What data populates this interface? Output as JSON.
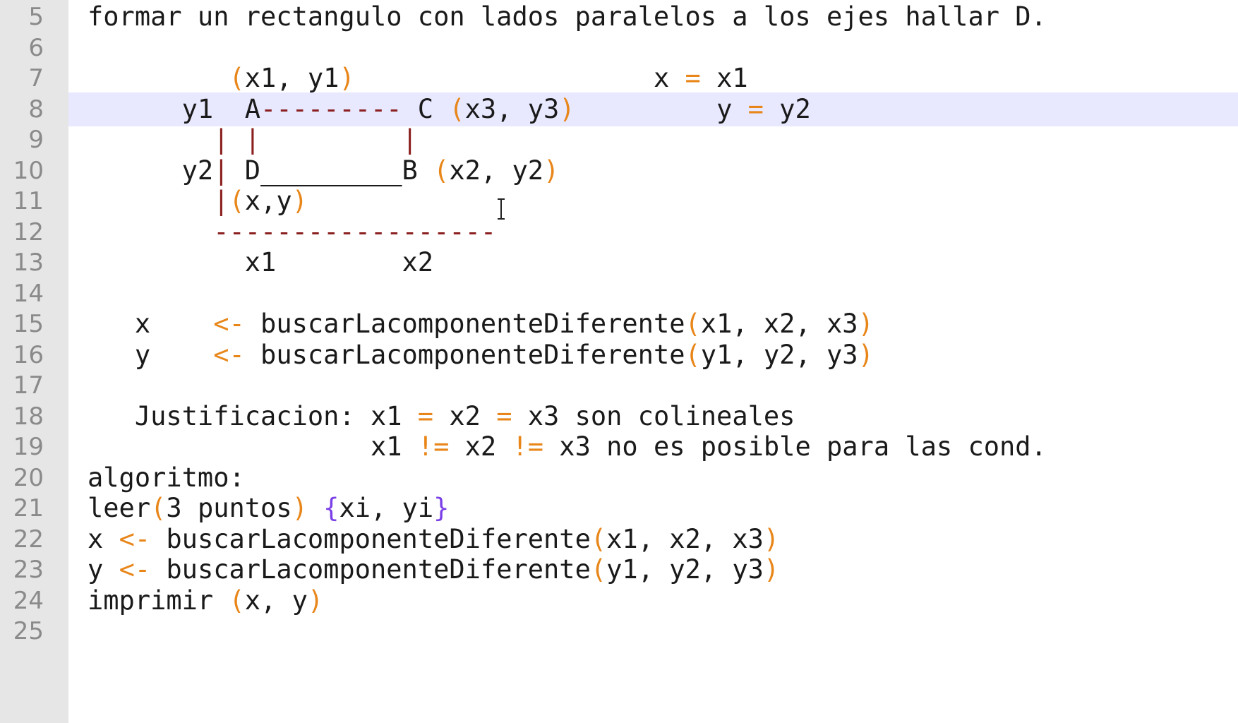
{
  "editor": {
    "line_numbers": [
      "5",
      "6",
      "7",
      "8",
      "9",
      "10",
      "11",
      "12",
      "13",
      "14",
      "15",
      "16",
      "17",
      "18",
      "19",
      "20",
      "21",
      "22",
      "23",
      "24",
      "25"
    ],
    "active_line_number": "8",
    "colors": {
      "gutter_bg": "#e6e6e6",
      "active_line_bg": "#e8e8ff",
      "operator": "#e8861a",
      "brace": "#7a3fe6",
      "dashes": "#8b2020"
    },
    "lines": {
      "l5": "formar un rectangulo con lados paralelos a los ejes hallar D.",
      "l7": {
        "p1": "         ",
        "lp": "(",
        "t1": "x1, y1",
        "rp": ")",
        "sp": "                   ",
        "t2": "x ",
        "eq": "=",
        "t3": " x1"
      },
      "l8": {
        "t1": "      y1  A",
        "dash": "---------",
        "t2": " C ",
        "lp": "(",
        "t3": "x3, y3",
        "rp": ")",
        "sp": "         ",
        "t4": "y ",
        "eq": "=",
        "t5": " y2"
      },
      "l9": {
        "p1": "        ",
        "bar1": "|",
        "sp1": " ",
        "bar2": "|",
        "sp2": "         ",
        "bar3": "|"
      },
      "l10": {
        "t1": "      y2",
        "bar": "|",
        "t2": " D",
        "under": "         ",
        "t3": "B ",
        "lp": "(",
        "t4": "x2, y2",
        "rp": ")"
      },
      "l11": {
        "p1": "        ",
        "bar": "|",
        "lp": "(",
        "t1": "x,y",
        "rp": ")"
      },
      "l12": {
        "p1": "        ",
        "dash": "------------------"
      },
      "l13": "          x1        x2",
      "l15": {
        "p1": "   x    ",
        "arrow": "<-",
        "t1": " buscarLacomponenteDiferente",
        "lp": "(",
        "t2": "x1, x2, x3",
        "rp": ")"
      },
      "l16": {
        "p1": "   y    ",
        "arrow": "<-",
        "t1": " buscarLacomponenteDiferente",
        "lp": "(",
        "t2": "y1, y2, y3",
        "rp": ")"
      },
      "l18": {
        "t1": "   Justificacion: x1 ",
        "eq1": "=",
        "t2": " x2 ",
        "eq2": "=",
        "t3": " x3 son colineales"
      },
      "l19": {
        "t1": "                  x1 ",
        "ne1": "!=",
        "t2": " x2 ",
        "ne2": "!=",
        "t3": " x3 no es posible para las cond."
      },
      "l20": "algoritmo:",
      "l21": {
        "t1": "leer",
        "lp": "(",
        "t2": "3 puntos",
        "rp": ")",
        "sp": " ",
        "lb": "{",
        "t3": "xi, yi",
        "rb": "}"
      },
      "l22": {
        "t1": "x ",
        "arrow": "<-",
        "t2": " buscarLacomponenteDiferente",
        "lp": "(",
        "t3": "x1, x2, x3",
        "rp": ")"
      },
      "l23": {
        "t1": "y ",
        "arrow": "<-",
        "t2": " buscarLacomponenteDiferente",
        "lp": "(",
        "t3": "y1, y2, y3",
        "rp": ")"
      },
      "l24": {
        "t1": "imprimir ",
        "lp": "(",
        "t2": "x, y",
        "rp": ")"
      }
    },
    "cursor_icon": "text-cursor-icon"
  }
}
